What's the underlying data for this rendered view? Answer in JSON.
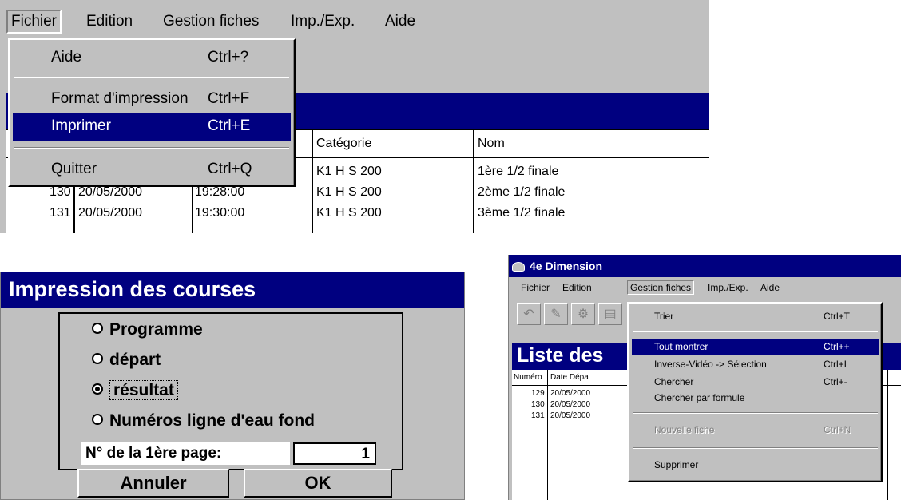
{
  "panel1": {
    "menubar": [
      "Fichier",
      "Edition",
      "Gestion fiches",
      "Imp./Exp.",
      "Aide"
    ],
    "dropdown": {
      "items": [
        {
          "label": "Aide",
          "shortcut": "Ctrl+?"
        },
        {
          "label": "Format d'impression",
          "shortcut": "Ctrl+F"
        },
        {
          "label": "Imprimer",
          "shortcut": "Ctrl+E"
        },
        {
          "label": "Quitter",
          "shortcut": "Ctrl+Q"
        }
      ]
    },
    "table": {
      "headers": [
        "Catégorie",
        "Nom"
      ],
      "rows": [
        {
          "num": "",
          "date": "",
          "time": "",
          "cat": "K1 H S 200",
          "nom": "1ère 1/2 finale"
        },
        {
          "num": "130",
          "date": "20/05/2000",
          "time": "19:28:00",
          "cat": "K1 H S 200",
          "nom": "2ème 1/2 finale"
        },
        {
          "num": "131",
          "date": "20/05/2000",
          "time": "19:30:00",
          "cat": "K1 H S 200",
          "nom": "3ème 1/2 finale"
        }
      ]
    }
  },
  "panel2": {
    "title": "Impression des courses",
    "options": [
      {
        "label": "Programme",
        "selected": false
      },
      {
        "label": "départ",
        "selected": false
      },
      {
        "label": "résultat",
        "selected": true
      },
      {
        "label": "Numéros ligne d'eau fond",
        "selected": false
      }
    ],
    "page_label": "N° de la 1ère page:",
    "page_value": "1",
    "cancel_label": "Annuler",
    "ok_label": "OK"
  },
  "panel3": {
    "window_title": "4e Dimension",
    "menubar": [
      "Fichier",
      "Edition",
      "Gestion fiches",
      "Imp./Exp.",
      "Aide"
    ],
    "list_title": "Liste des",
    "list_headers": [
      "Numéro",
      "Date Dépa"
    ],
    "list_rows": [
      {
        "num": "129",
        "date": "20/05/2000"
      },
      {
        "num": "130",
        "date": "20/05/2000"
      },
      {
        "num": "131",
        "date": "20/05/2000"
      }
    ],
    "dropdown": [
      {
        "label": "Trier",
        "shortcut": "Ctrl+T"
      },
      {
        "label": "Tout montrer",
        "shortcut": "Ctrl++"
      },
      {
        "label": "Inverse-Vidéo -> Sélection",
        "shortcut": "Ctrl+I"
      },
      {
        "label": "Chercher",
        "shortcut": "Ctrl+-"
      },
      {
        "label": "Chercher par formule",
        "shortcut": ""
      },
      {
        "label": "Nouvelle fiche",
        "shortcut": "Ctrl+N"
      },
      {
        "label": "Supprimer",
        "shortcut": ""
      }
    ]
  }
}
